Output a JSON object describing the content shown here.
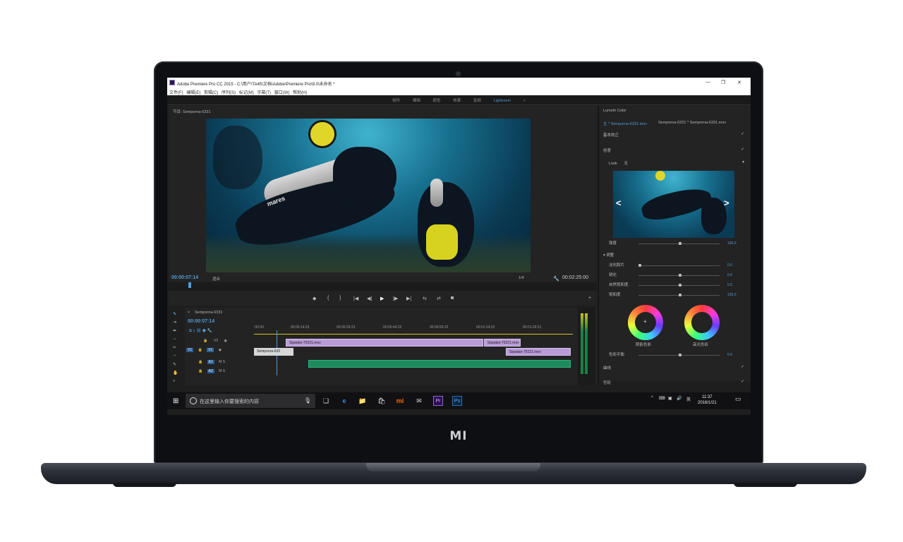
{
  "device": {
    "logo": "MI"
  },
  "window": {
    "title": "Adobe Premiere Pro CC 2015 - C:\\用户\\TA45\\文档\\Adobe\\Premiere Pro\\9.0\\未命名 *",
    "controls": [
      "—",
      "❐",
      "✕"
    ]
  },
  "menu": [
    "文件(F)",
    "编辑(E)",
    "剪辑(C)",
    "序列(S)",
    "标记(M)",
    "字幕(T)",
    "窗口(W)",
    "帮助(H)"
  ],
  "workspaces": {
    "items": [
      "组件",
      "编辑",
      "颜色",
      "效果",
      "音频",
      "Lightroom"
    ],
    "active": "Lightroom",
    "more": "»"
  },
  "program_monitor": {
    "tab": "节目: Semporna-6331",
    "timecode": "00:00:07:14",
    "fit": "适合",
    "resolution": "1/4",
    "duration": "00:02:25:00"
  },
  "transport_labels": [
    "◆",
    "{",
    "}",
    "|◀",
    "◀|",
    "▶",
    "|▶",
    "▶|",
    "⇆",
    "⇄",
    "◙",
    "+"
  ],
  "lumetri": {
    "tab": "Lumetri Color",
    "clip_path": "主 * Semporna-6331.mov",
    "clip_path2": "Semporna-6331 * Semporna-6331.mov",
    "basic": "基本校正",
    "creative": "创意",
    "look_label": "Look",
    "look_value": "无",
    "intensity_label": "强度",
    "intensity_value": "100.0",
    "adjust": "调整",
    "sliders": [
      {
        "label": "淡化胶片",
        "value": "0.0"
      },
      {
        "label": "锐化",
        "value": "0.0"
      },
      {
        "label": "自然饱和度",
        "value": "0.0"
      },
      {
        "label": "饱和度",
        "value": "100.0"
      }
    ],
    "wheel1": "阴影色彩",
    "wheel2": "高光色彩",
    "balance_label": "色彩平衡",
    "balance_value": "0.0",
    "curves": "曲线",
    "color_wheels": "色轮"
  },
  "timeline": {
    "tab": "Semporna-6331",
    "timecode": "00:00:07:14",
    "ruler": [
      ":00:00",
      "00:00:14:23",
      "00:00:29:23",
      "00:00:44:22",
      "00:00:59:22",
      "00:01:14:22",
      "00:01:29:21"
    ],
    "tracks": [
      {
        "name": "V2",
        "src": ""
      },
      {
        "name": "V1",
        "src": "V1"
      },
      {
        "name": "A1",
        "src": ""
      },
      {
        "name": "A2",
        "src": ""
      }
    ],
    "clips": [
      {
        "label": "Sipadan-79221.mov",
        "kind": "v"
      },
      {
        "label": "Sipadan-79221.mov",
        "kind": "v"
      },
      {
        "label": "Semporna-633",
        "kind": "v2"
      },
      {
        "label": "Sipadan-79221.mov",
        "kind": "v"
      },
      {
        "label": "",
        "kind": "a"
      }
    ]
  },
  "taskbar": {
    "search_placeholder": "在这里输入你要搜索的内容",
    "time": "11:37",
    "date": "2016/1/21",
    "apps": [
      "❑",
      "e",
      "📁",
      "🛍",
      "mi",
      "✉",
      "Pr",
      "Ps"
    ],
    "tray": [
      "^",
      "⌨",
      "▣",
      "🔊",
      "英"
    ]
  },
  "colors": {
    "accent": "#4f9bd8",
    "panel": "#232323",
    "clip_video": "#b99bd8",
    "clip_audio": "#1f8a5e"
  }
}
